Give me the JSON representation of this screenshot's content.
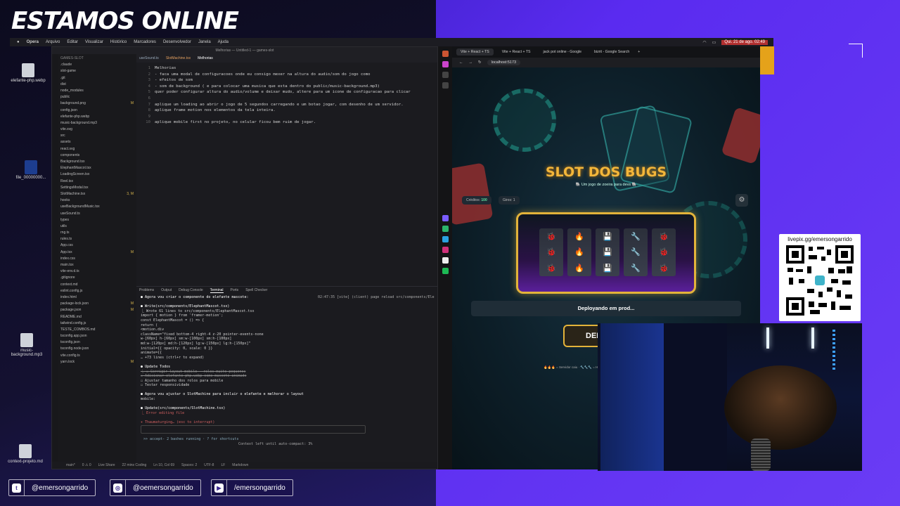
{
  "stream": {
    "title": "ESTAMOS ONLINE",
    "socials": [
      {
        "icon": "twitter-icon",
        "handle": "@emersongarrido"
      },
      {
        "icon": "instagram-icon",
        "handle": "@oemersongarrido"
      },
      {
        "icon": "youtube-icon",
        "handle": "/emersongarrido"
      }
    ],
    "qr_label": "livepix.gg/emersongarrido"
  },
  "desktop": {
    "icons": [
      {
        "label": "elefante-php.webp"
      },
      {
        "label": "file_00000000..."
      },
      {
        "label": "music-background.mp3"
      },
      {
        "label": "context-projeto.md"
      }
    ]
  },
  "menubar": {
    "app": "Opera",
    "items": [
      "Arquivo",
      "Editar",
      "Visualizar",
      "Histórico",
      "Marcadores",
      "Desenvolvedor",
      "Janela",
      "Ajuda"
    ],
    "datetime": "Qui. 21 de ago. 02:49"
  },
  "vscode": {
    "title": "Melhorias — Untitled-1 — games-slot",
    "explorer_title": "GAMES-SLOT",
    "explorer": [
      {
        "name": ".claude",
        "mod": ""
      },
      {
        "name": "slot-game",
        "mod": ""
      },
      {
        "name": ".git",
        "mod": ""
      },
      {
        "name": "dist",
        "mod": ""
      },
      {
        "name": "node_modules",
        "mod": ""
      },
      {
        "name": "public",
        "mod": ""
      },
      {
        "name": "background.png",
        "mod": "M"
      },
      {
        "name": "config.json",
        "mod": ""
      },
      {
        "name": "elefante-php.webp",
        "mod": ""
      },
      {
        "name": "music-background.mp3",
        "mod": ""
      },
      {
        "name": "vite.svg",
        "mod": ""
      },
      {
        "name": "src",
        "mod": ""
      },
      {
        "name": "assets",
        "mod": ""
      },
      {
        "name": "react.svg",
        "mod": ""
      },
      {
        "name": "components",
        "mod": ""
      },
      {
        "name": "Background.tsx",
        "mod": ""
      },
      {
        "name": "ElephantMascot.tsx",
        "mod": ""
      },
      {
        "name": "LoadingScreen.tsx",
        "mod": ""
      },
      {
        "name": "Reel.tsx",
        "mod": ""
      },
      {
        "name": "SettingsModal.tsx",
        "mod": ""
      },
      {
        "name": "SlotMachine.tsx",
        "mod": "3, M"
      },
      {
        "name": "hooks",
        "mod": ""
      },
      {
        "name": "useBackgroundMusic.tsx",
        "mod": ""
      },
      {
        "name": "useSound.ts",
        "mod": ""
      },
      {
        "name": "types",
        "mod": ""
      },
      {
        "name": "utils",
        "mod": ""
      },
      {
        "name": "rng.ts",
        "mod": ""
      },
      {
        "name": "rules.ts",
        "mod": ""
      },
      {
        "name": "App.css",
        "mod": ""
      },
      {
        "name": "App.tsx",
        "mod": "M"
      },
      {
        "name": "index.css",
        "mod": ""
      },
      {
        "name": "main.tsx",
        "mod": ""
      },
      {
        "name": "vite-env.d.ts",
        "mod": ""
      },
      {
        "name": ".gitignore",
        "mod": ""
      },
      {
        "name": "context.md",
        "mod": ""
      },
      {
        "name": "eslint.config.js",
        "mod": ""
      },
      {
        "name": "index.html",
        "mod": ""
      },
      {
        "name": "package-lock.json",
        "mod": "M"
      },
      {
        "name": "package.json",
        "mod": "M"
      },
      {
        "name": "README.md",
        "mod": ""
      },
      {
        "name": "tailwind.config.js",
        "mod": ""
      },
      {
        "name": "TESTE_COMBOS.md",
        "mod": ""
      },
      {
        "name": "tsconfig.app.json",
        "mod": ""
      },
      {
        "name": "tsconfig.json",
        "mod": ""
      },
      {
        "name": "tsconfig.node.json",
        "mod": ""
      },
      {
        "name": "vite.config.ts",
        "mod": ""
      },
      {
        "name": "yarn.lock",
        "mod": "M"
      }
    ],
    "tabs": [
      "useSound.ts",
      "SlotMachine.tsx",
      "Melhorias"
    ],
    "editor_lines": [
      {
        "n": "1",
        "text": "Melhorias"
      },
      {
        "n": "2",
        "text": "- faca uma modal de configuracoes onde eu consigo mexer na altura do audio/som do jogo como"
      },
      {
        "n": "3",
        "text": "- efeitos de som"
      },
      {
        "n": "4",
        "text": "- som de background ( e para colocar uma musica que esta dentro do public/music-background.mp3)"
      },
      {
        "n": "5",
        "text": "quer poder configurar altura do audio/volume e deixar mudo, altere para um icone de configuracao para clicar"
      },
      {
        "n": "6",
        "text": ""
      },
      {
        "n": "7",
        "text": "aplique um loading ao abrir o jogo de 5 segundos carregando e um botao jogar, com desenho de um servidor."
      },
      {
        "n": "8",
        "text": "aplique frame motion nos elementos da tela inteira."
      },
      {
        "n": "9",
        "text": ""
      },
      {
        "n": "10",
        "text": "aplique mobile first no projeto, no celular ficou bem ruim de jogar."
      }
    ],
    "panel_tabs": [
      "Problems",
      "Output",
      "Debug Console",
      "Terminal",
      "Ports",
      "Spell Checker"
    ],
    "terminal": [
      {
        "cls": "ok",
        "text": "● Agora vou criar o componente do elefante mascote:"
      },
      {
        "cls": "",
        "text": ""
      },
      {
        "cls": "ok",
        "text": "● Write(src/components/ElephantMascot.tsx)"
      },
      {
        "cls": "",
        "text": "  ⎿ Wrote 61 lines to src/components/ElephantMascot.tsx"
      },
      {
        "cls": "",
        "text": "     import { motion } from 'framer-motion';"
      },
      {
        "cls": "",
        "text": "     const ElephantMascot = () => {"
      },
      {
        "cls": "",
        "text": "       return ("
      },
      {
        "cls": "",
        "text": "         <motion.div"
      },
      {
        "cls": "",
        "text": "           className=\"fixed bottom-4 right-4 z-20 pointer-events-none"
      },
      {
        "cls": "",
        "text": "                     w-[60px] h-[60px] sm:w-[100px] sm:h-[100px]"
      },
      {
        "cls": "",
        "text": "                     md:w-[120px] md:h-[120px] lg:w-[150px] lg:h-[150px]\""
      },
      {
        "cls": "",
        "text": "           initial={{ opacity: 0, scale: 0 }}"
      },
      {
        "cls": "",
        "text": "           animate={{"
      },
      {
        "cls": "",
        "text": "     … +73 lines (ctrl+r to expand)"
      },
      {
        "cls": "",
        "text": ""
      },
      {
        "cls": "ok",
        "text": "● Update Todos"
      },
      {
        "cls": "del",
        "text": "  ⎿ ☒ Corrigir layout mobile - rolos muito pequenos"
      },
      {
        "cls": "del",
        "text": "    ☒ Adicionar elefante-php.webp como mascote animado"
      },
      {
        "cls": "",
        "text": "    ☐ Ajustar tamanho dos rolos para mobile"
      },
      {
        "cls": "",
        "text": "    ☐ Testar responsividade"
      },
      {
        "cls": "",
        "text": ""
      },
      {
        "cls": "ok",
        "text": "● Agora vou ajustar o SlotMachine para incluir o elefante e melhorar o layout"
      },
      {
        "cls": "",
        "text": "   mobile:"
      },
      {
        "cls": "",
        "text": ""
      },
      {
        "cls": "ok",
        "text": "● Update(src/components/SlotMachine.tsx)"
      },
      {
        "cls": "red",
        "text": "  ⎿ Error editing file"
      },
      {
        "cls": "",
        "text": ""
      },
      {
        "cls": "red",
        "text": "✶ Thaumaturging… (esc to interrupt)"
      }
    ],
    "terminal_right": "02:47:35 [vite] (client) page reload src/components/Ele",
    "prompt_hint": ">> accept-  2 bashes running · ? for shortcuts",
    "context_hint": "Context left until auto-compact: 3%",
    "status": [
      "main*",
      "0 ⚠ 0",
      "Live Share",
      "22 mins Coding",
      "Ln 10, Col 69",
      "Spaces: 2",
      "UTF-8",
      "LF",
      "Markdown"
    ]
  },
  "browser": {
    "tabs": [
      "Vite + React + TS",
      "Vite + React + TS",
      "jack pot online - Google",
      "bizrit - Google Search"
    ],
    "url": "localhost:5173",
    "game": {
      "title": "SLOT DOS BUGS",
      "subtitle": "🐘 Um jogo de zoeira para devs 🐘",
      "credits_label": "Créditos:",
      "credits_value": "100",
      "spins_label": "Giros:",
      "spins_value": "1",
      "reels": [
        [
          "🐞",
          "🐞",
          "🐞"
        ],
        [
          "🔥",
          "🔥",
          "🔥"
        ],
        [
          "💾",
          "💾",
          "💾"
        ],
        [
          "🔧",
          "🔧",
          "🔧"
        ],
        [
          "🐞",
          "🐞",
          "🐞"
        ]
      ],
      "deploy_message": "Deployando em prod...",
      "spin_button": "DEPLOY",
      "footer": "🔥🔥🔥 = Servidor caiu ·  🔧🔧🔧 = Hotfix ·  Combinações"
    }
  },
  "colors": {
    "accent_gold": "#e3b33a",
    "brand_purple": "#5a2bf0"
  }
}
